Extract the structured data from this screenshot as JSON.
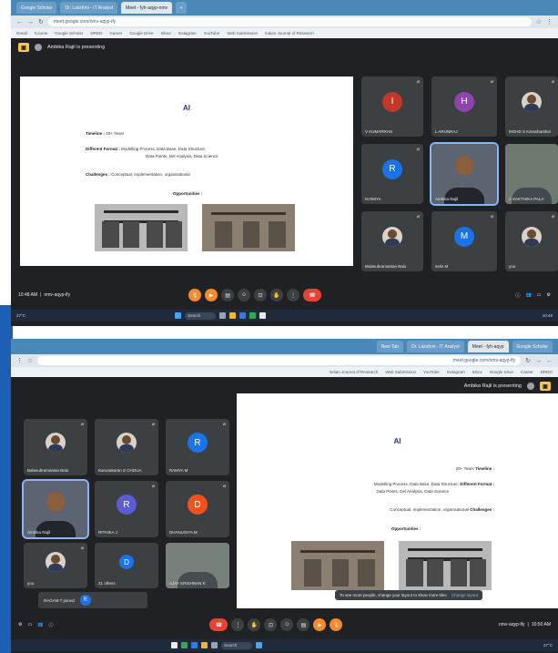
{
  "screenshot1": {
    "tabs": [
      "Google Scholar",
      "Dr. Lakshmi - IT Analyst",
      "Meet - fyh-aqyp-nmv",
      ""
    ],
    "url": "meet.google.com/nmv-aqyp-lfy",
    "bookmarks": [
      "Gmail",
      "Course",
      "Google Scholar",
      "DRDO",
      "Career",
      "Google Drive",
      "Inbox",
      "Instagram",
      "YouTube",
      "Web Submission",
      "Indian Journal of Research"
    ],
    "meet_status": "Ambika Rajil is presenting",
    "slide": {
      "title": "AI",
      "timeline_label": "Timeline :",
      "timeline_value": "20+ Years",
      "formats_label": "Different Format :",
      "formats_value_1": "Modelling Process, Data Base, Data Structure,",
      "formats_value_2": "Data Points, Del Analysis, Data Science",
      "challenges_label": "Challenges :",
      "challenges_value": "Conceptual, Implementation, organisational",
      "opportunities_label": "Opportunities :"
    },
    "participants": [
      {
        "name": "V KUMARRAN",
        "initial": "I",
        "color": "#c0392b"
      },
      {
        "name": "L ARUNRAJ",
        "initial": "H",
        "color": "#8e44ad"
      },
      {
        "name": "MOHD S Karashanthal",
        "initial": "",
        "color": ""
      },
      {
        "name": "M RMYA",
        "initial": "R",
        "color": "#1a73e8"
      },
      {
        "name": "Ambika Rajil",
        "initial": "",
        "color": ""
      },
      {
        "name": "A SAKTHIKA PALA",
        "initial": "",
        "color": ""
      },
      {
        "name": "Balasubramanian Balu",
        "initial": "",
        "color": ""
      },
      {
        "name": "selin M",
        "initial": "M",
        "color": "#1a73e8"
      },
      {
        "name": "you",
        "initial": "",
        "color": ""
      }
    ],
    "meeting_time": "10:48 AM",
    "meeting_code": "nmv-aqyp-lfy",
    "taskbar_search": "Search",
    "taskbar_weather": "27°C",
    "taskbar_clock": "10:48"
  },
  "screenshot2": {
    "tabs": [
      "Google Scholar",
      "Meet - fyh-aqyp",
      "Dr. Lakshmi - IT Analyst",
      "New Tab"
    ],
    "url": "meet.google.com/nmv-aqyp-lfy",
    "meet_status": "Ambika Rajil is presenting",
    "participants": [
      {
        "name": "Balasubramanian Balu",
        "initial": "",
        "color": ""
      },
      {
        "name": "Karunakaran S CHOUA",
        "initial": "",
        "color": ""
      },
      {
        "name": "RAMYA M",
        "initial": "R",
        "color": "#1a73e8"
      },
      {
        "name": "Ambika Rajil",
        "initial": "",
        "color": ""
      },
      {
        "name": "RITHIKA J",
        "initial": "R",
        "color": "#5b5bd6"
      },
      {
        "name": "DHANUSIYA M",
        "initial": "D",
        "color": "#f4511e"
      },
      {
        "name": "you",
        "initial": "",
        "color": ""
      },
      {
        "name": "21 others",
        "initial": "D",
        "color": "#1a73e8"
      },
      {
        "name": "AJAY KRISHNAN K",
        "initial": "",
        "color": ""
      }
    ],
    "joined_text": "RAGAM T joined",
    "joined_initial": "R",
    "toast_text": "To see more people, change your layout to show more tiles",
    "toast_action": "Change layout",
    "meeting_time": "10:50 AM",
    "meeting_code": "nmv-aqyp-lfy",
    "taskbar_search": "Search",
    "taskbar_weather": "27°C"
  }
}
